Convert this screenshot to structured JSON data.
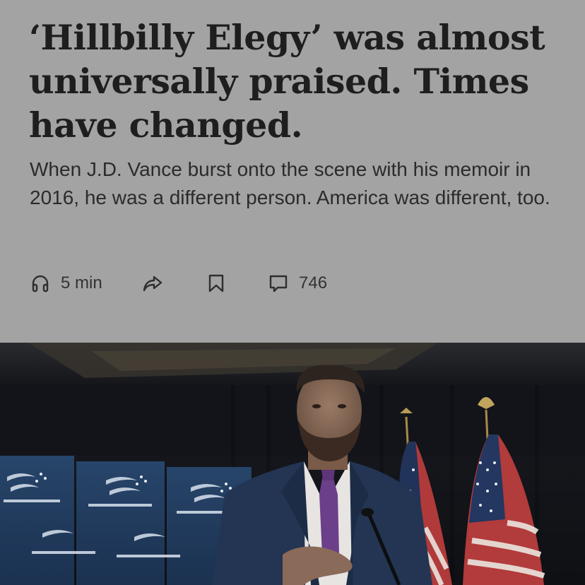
{
  "article": {
    "headline": "‘Hillbilly Elegy’ was almost universally praised. Times have changed.",
    "dek": "When J.D. Vance burst onto the scene with his memoir in 2016, he was a different person. America was different, too."
  },
  "actions": {
    "listen": {
      "icon": "headphones-icon",
      "label": "5 min"
    },
    "share": {
      "icon": "share-arrow-icon"
    },
    "save": {
      "icon": "bookmark-icon"
    },
    "comments": {
      "icon": "comment-icon",
      "count": "746"
    }
  },
  "colors": {
    "header_background": "#a3a3a3",
    "headline_text": "#1e1e1e",
    "body_text": "#2b2b2b"
  }
}
